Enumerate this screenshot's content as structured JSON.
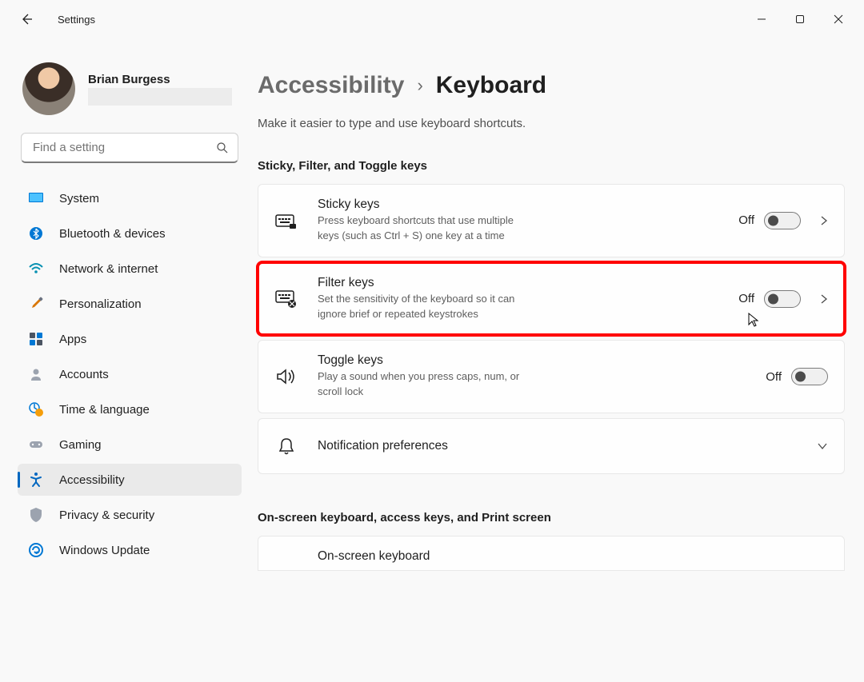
{
  "app": {
    "title": "Settings"
  },
  "user": {
    "name": "Brian Burgess"
  },
  "search": {
    "placeholder": "Find a setting"
  },
  "nav": {
    "items": [
      {
        "label": "System"
      },
      {
        "label": "Bluetooth & devices"
      },
      {
        "label": "Network & internet"
      },
      {
        "label": "Personalization"
      },
      {
        "label": "Apps"
      },
      {
        "label": "Accounts"
      },
      {
        "label": "Time & language"
      },
      {
        "label": "Gaming"
      },
      {
        "label": "Accessibility"
      },
      {
        "label": "Privacy & security"
      },
      {
        "label": "Windows Update"
      }
    ]
  },
  "breadcrumb": {
    "parent": "Accessibility",
    "current": "Keyboard"
  },
  "page": {
    "description": "Make it easier to type and use keyboard shortcuts."
  },
  "sections": {
    "s1": {
      "title": "Sticky, Filter, and Toggle keys",
      "items": {
        "sticky": {
          "title": "Sticky keys",
          "desc": "Press keyboard shortcuts that use multiple keys (such as Ctrl + S) one key at a time",
          "state": "Off"
        },
        "filter": {
          "title": "Filter keys",
          "desc": "Set the sensitivity of the keyboard so it can ignore brief or repeated keystrokes",
          "state": "Off"
        },
        "toggle": {
          "title": "Toggle keys",
          "desc": "Play a sound when you press caps, num, or scroll lock",
          "state": "Off"
        },
        "notif": {
          "title": "Notification preferences"
        }
      }
    },
    "s2": {
      "title": "On-screen keyboard, access keys, and Print screen",
      "items": {
        "osk": {
          "title": "On-screen keyboard"
        }
      }
    }
  }
}
